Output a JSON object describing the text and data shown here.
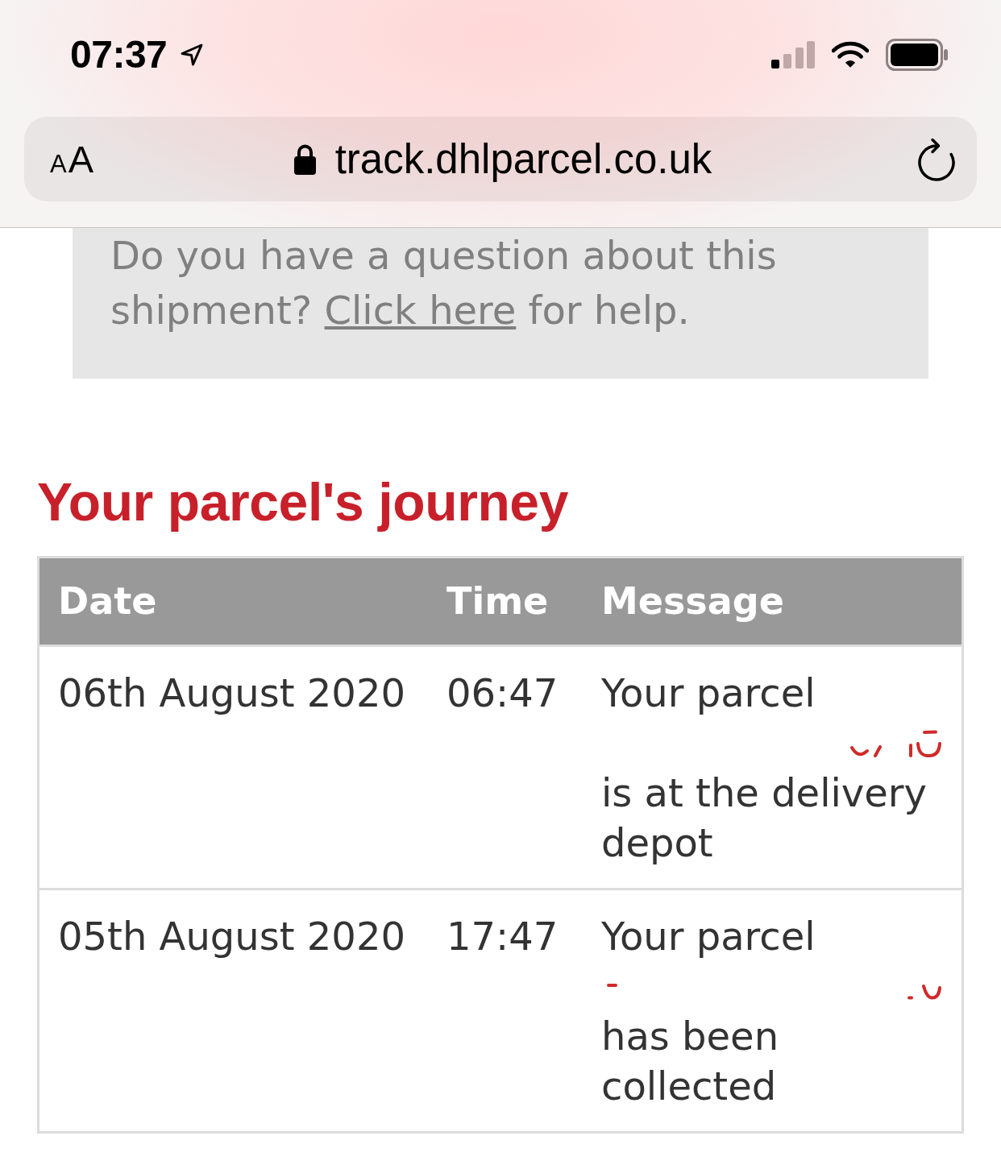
{
  "status_bar": {
    "time": "07:37"
  },
  "browser_bar": {
    "text_size_button": {
      "small_letter": "A",
      "large_letter": "A"
    },
    "secure": true,
    "url": "track.dhlparcel.co.uk"
  },
  "help_box": {
    "text_before": "Do you have a question about this shipment?",
    "link": "Click here",
    "text_after": "for help."
  },
  "heading": "Your parcel's journey",
  "table": {
    "columns": [
      "Date",
      "Time",
      "Message"
    ],
    "rows": [
      {
        "date": "06th August 2020",
        "time": "06:47",
        "message_start": "Your parcel",
        "redacted": true,
        "message_end": "is at the delivery depot"
      },
      {
        "date": "05th August 2020",
        "time": "17:47",
        "message_start": "Your parcel",
        "redacted": true,
        "message_end": "has been collected"
      }
    ]
  }
}
